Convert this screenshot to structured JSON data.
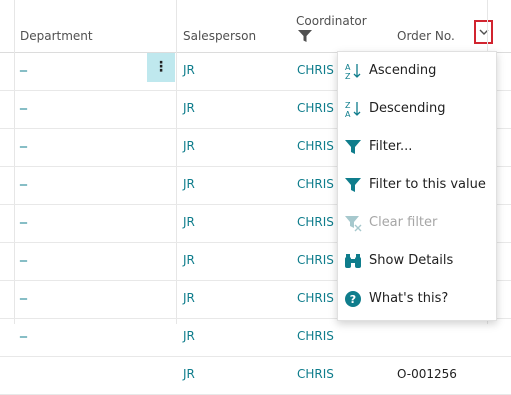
{
  "columns": {
    "department": "Department",
    "salesperson": "Salesperson",
    "coordinator": "Coordinator",
    "order_no": "Order No."
  },
  "rows": [
    {
      "department": "_",
      "salesperson": "JR",
      "coordinator": "CHRIS",
      "order_no": ""
    },
    {
      "department": "_",
      "salesperson": "JR",
      "coordinator": "CHRIS",
      "order_no": ""
    },
    {
      "department": "_",
      "salesperson": "JR",
      "coordinator": "CHRIS",
      "order_no": ""
    },
    {
      "department": "_",
      "salesperson": "JR",
      "coordinator": "CHRIS",
      "order_no": ""
    },
    {
      "department": "_",
      "salesperson": "JR",
      "coordinator": "CHRIS",
      "order_no": ""
    },
    {
      "department": "_",
      "salesperson": "JR",
      "coordinator": "CHRIS",
      "order_no": ""
    },
    {
      "department": "_",
      "salesperson": "JR",
      "coordinator": "CHRIS",
      "order_no": ""
    },
    {
      "department": "_",
      "salesperson": "JR",
      "coordinator": "CHRIS",
      "order_no": ""
    },
    {
      "department": "",
      "salesperson": "JR",
      "coordinator": "CHRIS",
      "order_no": "O-001256"
    }
  ],
  "row_menu_glyph": "⋮",
  "menu": {
    "items": [
      {
        "label": "Ascending",
        "icon": "sort-ascending-icon",
        "enabled": true
      },
      {
        "label": "Descending",
        "icon": "sort-descending-icon",
        "enabled": true
      },
      {
        "label": "Filter...",
        "icon": "filter-icon",
        "enabled": true
      },
      {
        "label": "Filter to this value",
        "icon": "filter-value-icon",
        "enabled": true
      },
      {
        "label": "Clear filter",
        "icon": "clear-filter-icon",
        "enabled": false
      },
      {
        "label": "Show Details",
        "icon": "binoculars-icon",
        "enabled": true
      },
      {
        "label": "What's this?",
        "icon": "help-icon",
        "enabled": true
      }
    ]
  },
  "colors": {
    "accent": "#0f7d8c",
    "selected_cell": "#bfe8ee",
    "focus_border": "#d1242f",
    "disabled_text": "#a6a6a6"
  }
}
